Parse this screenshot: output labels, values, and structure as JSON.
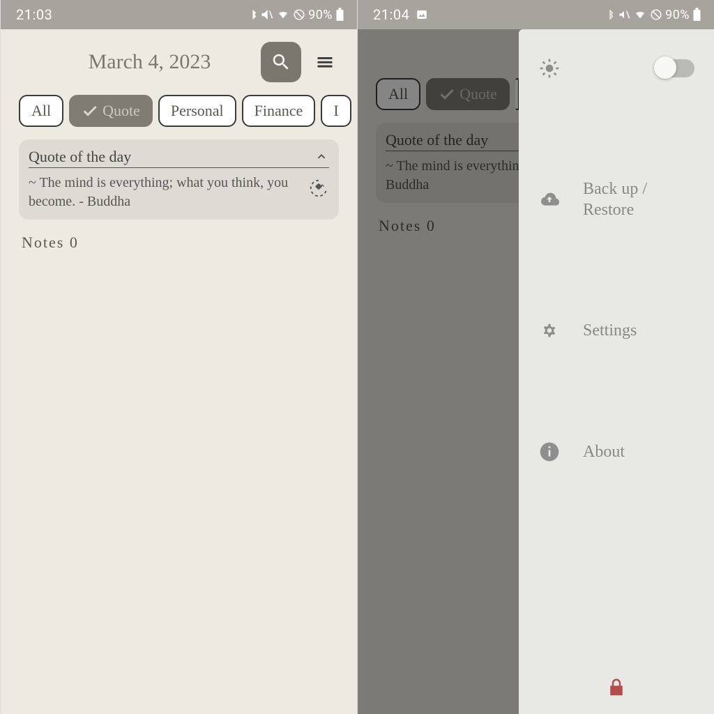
{
  "statusbar": {
    "left_time": "21:03",
    "right_time": "21:04",
    "battery": "90%"
  },
  "header": {
    "date": "March 4, 2023",
    "date_truncated": "March 4"
  },
  "chips": {
    "all": "All",
    "quote": "Quote",
    "personal": "Personal",
    "finance": "Finance",
    "idea": "I"
  },
  "quote": {
    "title": "Quote of the day",
    "text": "~ The mind is everything; what you think, you become. - Buddha"
  },
  "notes": {
    "label": "Notes 0"
  },
  "drawer": {
    "backup": "Back up / Restore",
    "settings": "Settings",
    "about": "About"
  }
}
